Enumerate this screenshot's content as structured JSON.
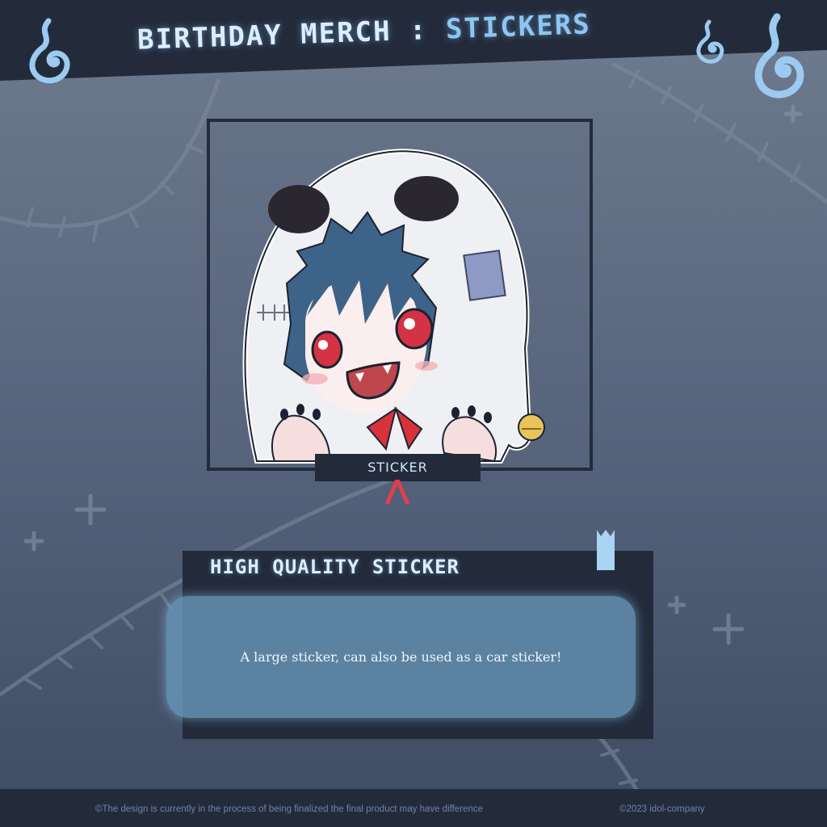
{
  "header": {
    "title_part1": "BIRTHDAY MERCH",
    "title_separator": ":",
    "title_part2": "STICKERS"
  },
  "product": {
    "image_icon": "chibi-ghost-hood-character-illustration",
    "tag_label": "STICKER"
  },
  "info": {
    "title": "HIGH QUALITY STICKER",
    "description": "A large sticker, can also be used as a car sticker!"
  },
  "footer": {
    "disclaimer": "©The design is currently in the process of being finalized the final product may have difference",
    "copyright": "©2023 idol-company"
  },
  "colors": {
    "dark_navy": "#232b3b",
    "accent_blue": "#8cc6f2",
    "light_text": "#dbeeff",
    "desc_box": "#6896b8"
  }
}
